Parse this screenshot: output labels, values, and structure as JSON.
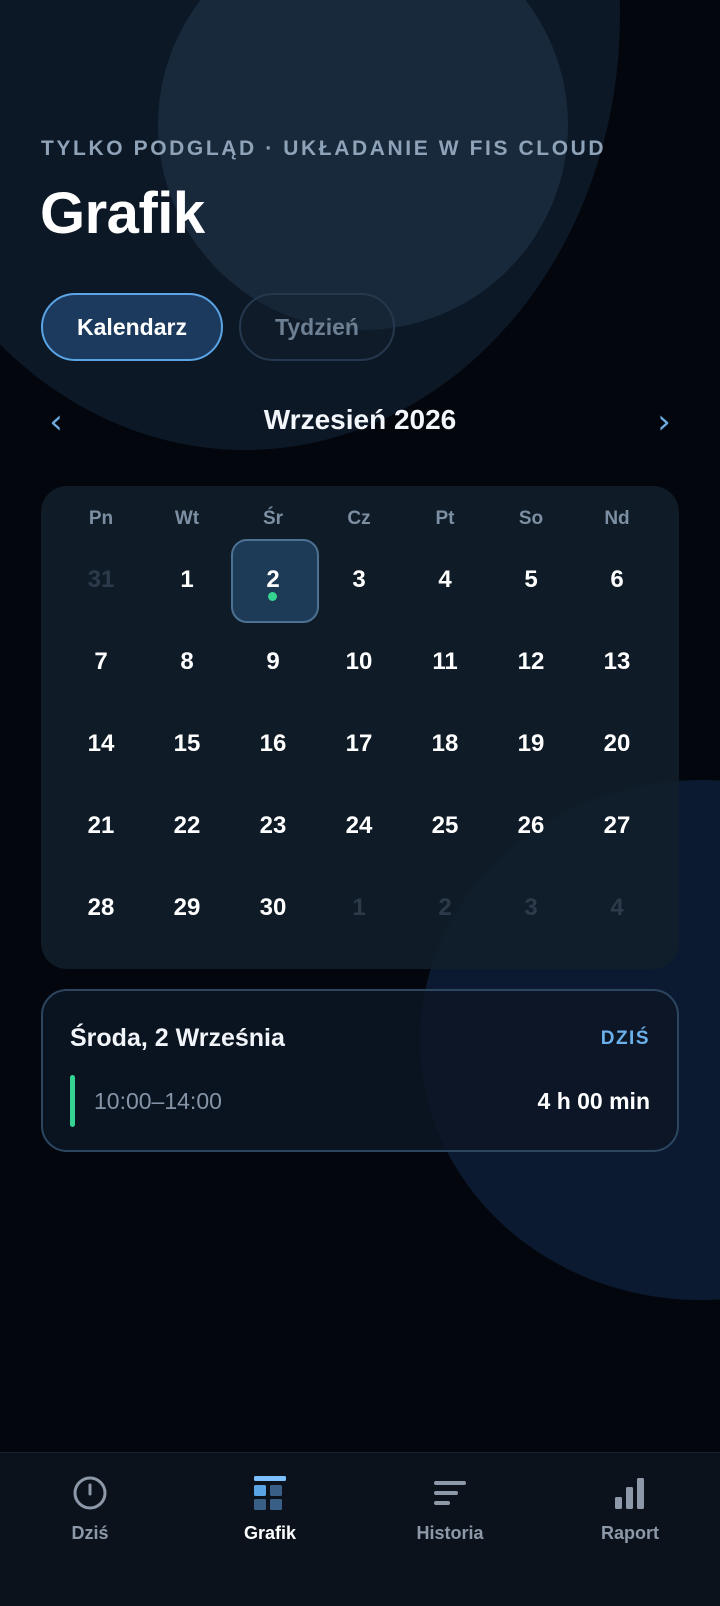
{
  "header": {
    "eyebrow": "TYLKO PODGLĄD · UKŁADANIE W FIS CLOUD",
    "title": "Grafik"
  },
  "view_toggle": {
    "calendar": "Kalendarz",
    "week": "Tydzień",
    "active": "calendar"
  },
  "month_nav": {
    "prev_icon": "chevron-left-icon",
    "next_icon": "chevron-right-icon",
    "prev_glyph": "‹",
    "next_glyph": "›",
    "label": "Wrzesień 2026"
  },
  "calendar": {
    "weekdays": [
      "Pn",
      "Wt",
      "Śr",
      "Cz",
      "Pt",
      "So",
      "Nd"
    ],
    "weeks": [
      [
        {
          "d": "31",
          "muted": true
        },
        {
          "d": "1"
        },
        {
          "d": "2",
          "selected": true,
          "dot": true
        },
        {
          "d": "3"
        },
        {
          "d": "4"
        },
        {
          "d": "5"
        },
        {
          "d": "6"
        }
      ],
      [
        {
          "d": "7"
        },
        {
          "d": "8"
        },
        {
          "d": "9"
        },
        {
          "d": "10"
        },
        {
          "d": "11"
        },
        {
          "d": "12"
        },
        {
          "d": "13"
        }
      ],
      [
        {
          "d": "14"
        },
        {
          "d": "15"
        },
        {
          "d": "16"
        },
        {
          "d": "17"
        },
        {
          "d": "18"
        },
        {
          "d": "19"
        },
        {
          "d": "20"
        }
      ],
      [
        {
          "d": "21"
        },
        {
          "d": "22"
        },
        {
          "d": "23"
        },
        {
          "d": "24"
        },
        {
          "d": "25"
        },
        {
          "d": "26"
        },
        {
          "d": "27"
        }
      ],
      [
        {
          "d": "28"
        },
        {
          "d": "29"
        },
        {
          "d": "30"
        },
        {
          "d": "1",
          "muted": true
        },
        {
          "d": "2",
          "muted": true
        },
        {
          "d": "3",
          "muted": true
        },
        {
          "d": "4",
          "muted": true
        }
      ]
    ]
  },
  "day_detail": {
    "title": "Środa, 2 Września",
    "badge": "DZIŚ",
    "shift_time": "10:00–14:00",
    "duration": "4 h 00 min"
  },
  "bottom_nav": [
    {
      "label": "Dziś",
      "icon": "clock-icon",
      "active": false
    },
    {
      "label": "Grafik",
      "icon": "schedule-grid-icon",
      "active": true
    },
    {
      "label": "Historia",
      "icon": "history-lines-icon",
      "active": false
    },
    {
      "label": "Raport",
      "icon": "bar-chart-icon",
      "active": false
    }
  ],
  "colors": {
    "background": "#03070d",
    "accent": "#5aa4e6",
    "shift_green": "#35d391",
    "muted_text": "#7d8fa3"
  }
}
